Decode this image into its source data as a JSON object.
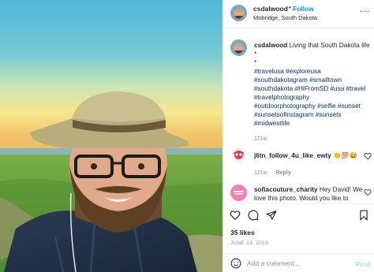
{
  "post": {
    "username": "csdalwood",
    "dot": "•",
    "follow_label": "Follow",
    "location": "Mobridge, South Dakota",
    "more_label": "..."
  },
  "caption": {
    "username": "csdalwood",
    "text": "Living that South Dakota life",
    "line2": "*",
    "line3": "*",
    "hashtags": [
      "#travelusa",
      "#exploreusa",
      "#southdakotagram",
      "#smalltown",
      "#southdakota",
      "#HiFromSD",
      "#usa",
      "#travel",
      "#travelphotography",
      "#outdoorphotography",
      "#selfie",
      "#sunset",
      "#sunsetsofinstagram",
      "#sunsets",
      "#midwestlife"
    ],
    "age": "121w"
  },
  "comments": [
    {
      "username": "j6tn_follow_4u_like_ewty",
      "text": "👏💯😅",
      "age": "121w",
      "reply_label": "Reply"
    },
    {
      "username": "sofiacouture_charity",
      "text": "Hey David! We love this photo. Would you like to"
    }
  ],
  "likes_text": "35 likes",
  "date_text": "JUNE 13, 2019",
  "add_comment": {
    "placeholder": "Add a comment...",
    "post_label": "Post"
  },
  "colors": {
    "link_blue": "#0095f6",
    "hashtag": "#00376b",
    "muted": "#8e8e8e",
    "post_disabled": "#b2dffc"
  },
  "icons": [
    "heart-icon",
    "comment-icon",
    "share-icon",
    "bookmark-icon",
    "emoji-icon",
    "more-icon"
  ]
}
